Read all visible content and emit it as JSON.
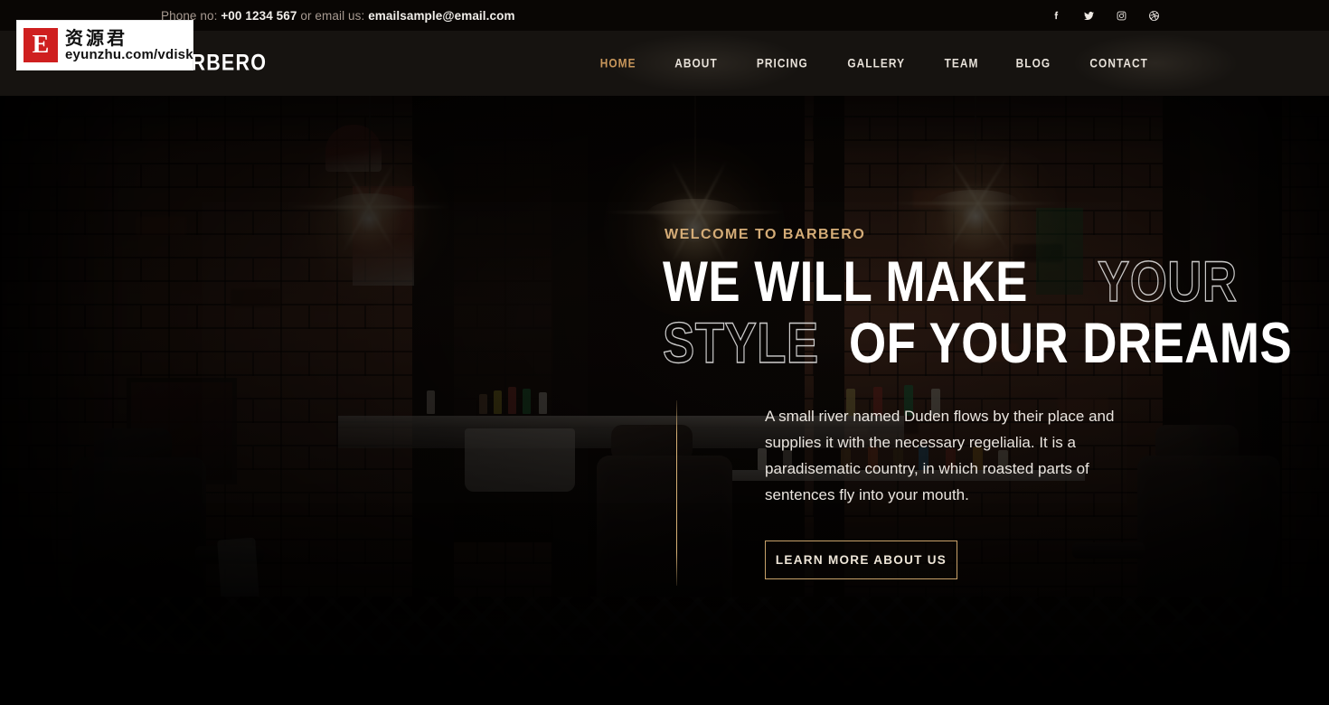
{
  "topbar": {
    "contact_prefix": "Phone no:",
    "phone": "+00 1234 567",
    "middle": "or email us:",
    "email": "emailsample@email.com",
    "socials": [
      {
        "name": "facebook-icon",
        "label": "Facebook"
      },
      {
        "name": "twitter-icon",
        "label": "Twitter"
      },
      {
        "name": "instagram-icon",
        "label": "Instagram"
      },
      {
        "name": "dribbble-icon",
        "label": "Dribbble"
      }
    ]
  },
  "header": {
    "logo": "BARBERO",
    "nav": [
      {
        "label": "HOME",
        "active": true
      },
      {
        "label": "ABOUT",
        "active": false
      },
      {
        "label": "PRICING",
        "active": false
      },
      {
        "label": "GALLERY",
        "active": false
      },
      {
        "label": "TEAM",
        "active": false
      },
      {
        "label": "BLOG",
        "active": false
      },
      {
        "label": "CONTACT",
        "active": false
      }
    ]
  },
  "hero": {
    "eyebrow": "WELCOME TO BARBERO",
    "headline_line1_solid": "WE WILL MAKE ",
    "headline_line1_outline": "YOUR",
    "headline_line2_outline": "STYLE",
    "headline_line2_solid": " OF YOUR DREAMS",
    "paragraph": "A small river named Duden flows by their place and supplies it with the necessary regelialia. It is a paradisematic country, in which roasted parts of sentences fly into your mouth.",
    "cta_label": "LEARN MORE ABOUT US"
  },
  "watermark": {
    "badge_letter": "E",
    "chinese": "资源君",
    "url": "eyunzhu.com/vdisk"
  },
  "colors": {
    "accent_gold": "#d4ac77",
    "active_nav": "#c9975b",
    "cta_border": "#c8a26a",
    "topbar_bg": "#0a0604",
    "header_bg": "#181512",
    "watermark_red": "#cf1f1f"
  }
}
